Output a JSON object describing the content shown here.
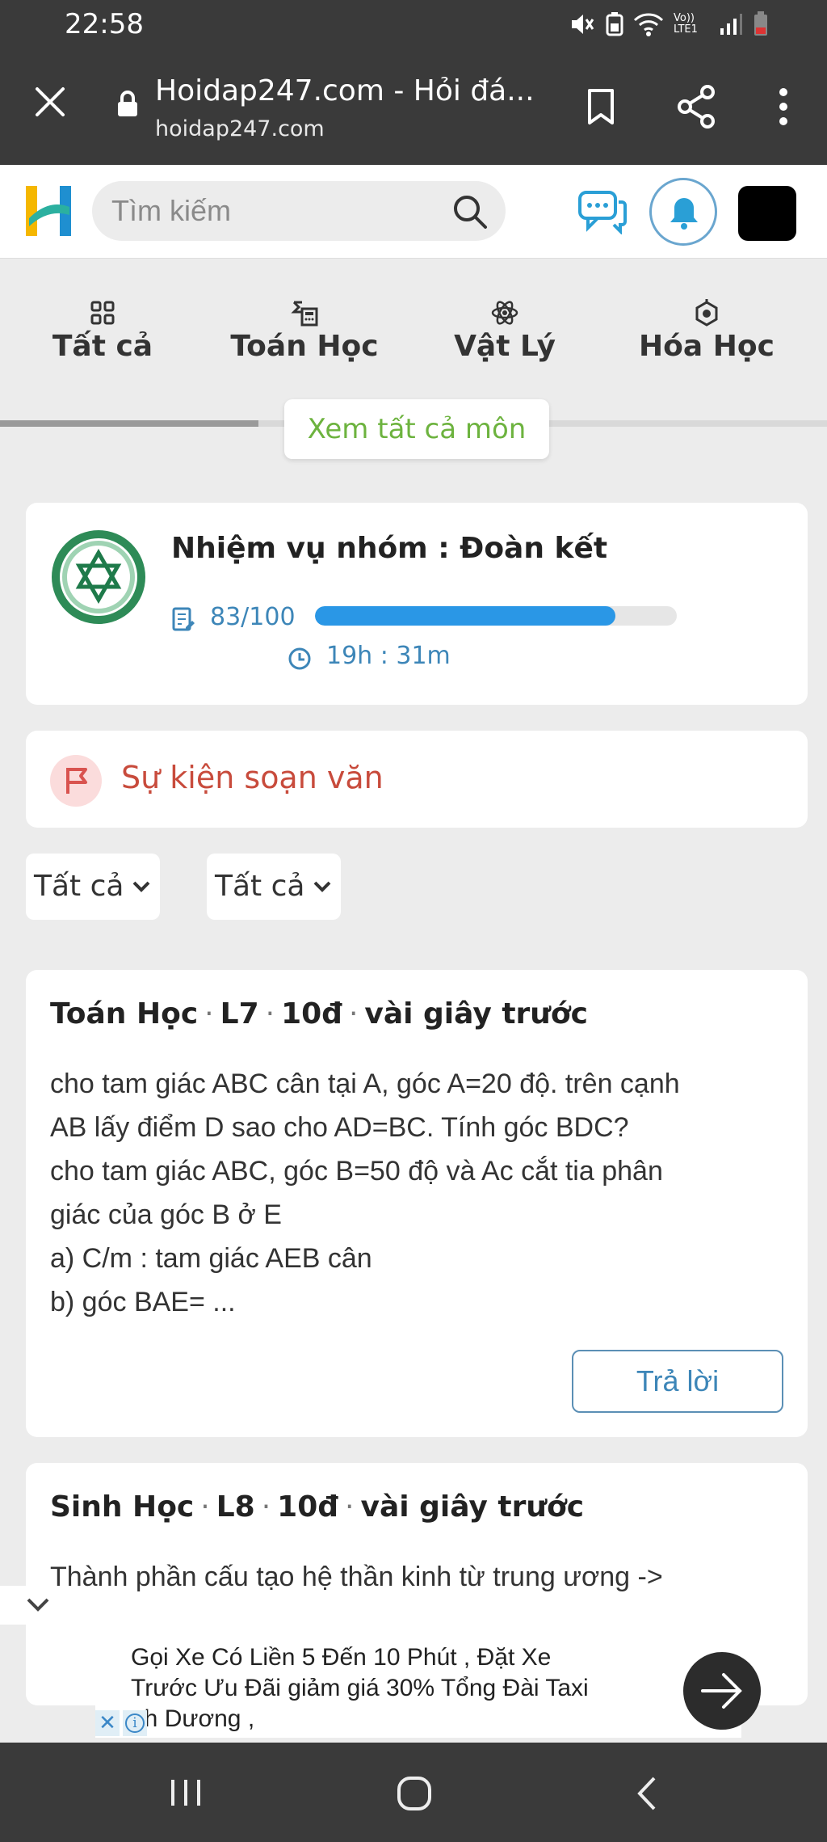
{
  "status_bar": {
    "time": "22:58",
    "network_label": "Vo)) LTE1"
  },
  "browser": {
    "page_title": "Hoidap247.com - Hỏi đá...",
    "url": "hoidap247.com"
  },
  "site_header": {
    "search_placeholder": "Tìm kiếm"
  },
  "subjects": [
    {
      "label": "Tất cả",
      "icon": "grid-icon"
    },
    {
      "label": "Toán Học",
      "icon": "calculator-icon"
    },
    {
      "label": "Vật Lý",
      "icon": "atom-icon"
    },
    {
      "label": "Hóa Học",
      "icon": "chemistry-icon"
    }
  ],
  "see_all_label": "Xem tất cả môn",
  "group_task": {
    "title": "Nhiệm vụ nhóm : Đoàn kết",
    "progress_text": "83/100",
    "progress_fraction": 0.83,
    "timer": "19h : 31m",
    "colors": {
      "bar": "#2a97e6",
      "badge": "#2e8b57"
    }
  },
  "event": {
    "label": "Sự kiện soạn văn",
    "color": "#c84b3c"
  },
  "filters": [
    {
      "value": "Tất cả"
    },
    {
      "value": "Tất cả"
    }
  ],
  "questions": [
    {
      "subject": "Toán Học",
      "grade": "L7",
      "points": "10đ",
      "time": "vài giây trước",
      "lines": [
        "cho tam giác ABC cân tại A, góc A=20 độ. trên cạnh",
        "AB lấy điểm D sao cho AD=BC. Tính góc BDC?",
        "cho tam giác ABC, góc B=50 độ và Ac cắt tia phân",
        "giác của góc B ở E",
        "a) C/m : tam giác AEB cân",
        "b) góc BAE= ..."
      ],
      "answer_label": "Trả lời"
    },
    {
      "subject": "Sinh Học",
      "grade": "L8",
      "points": "10đ",
      "time": "vài giây trước",
      "lines": [
        "Thành phần cấu tạo hệ thần kinh từ trung ương ->"
      ]
    }
  ],
  "ad": {
    "lines": [
      "Gọi Xe Có Liền 5 Đến 10 Phút , Đặt Xe",
      "Trước Ưu Đãi giảm giá 30% Tổng Đài Taxi",
      "nh Dương ,"
    ],
    "close_label": "✕",
    "info_label": "i"
  }
}
